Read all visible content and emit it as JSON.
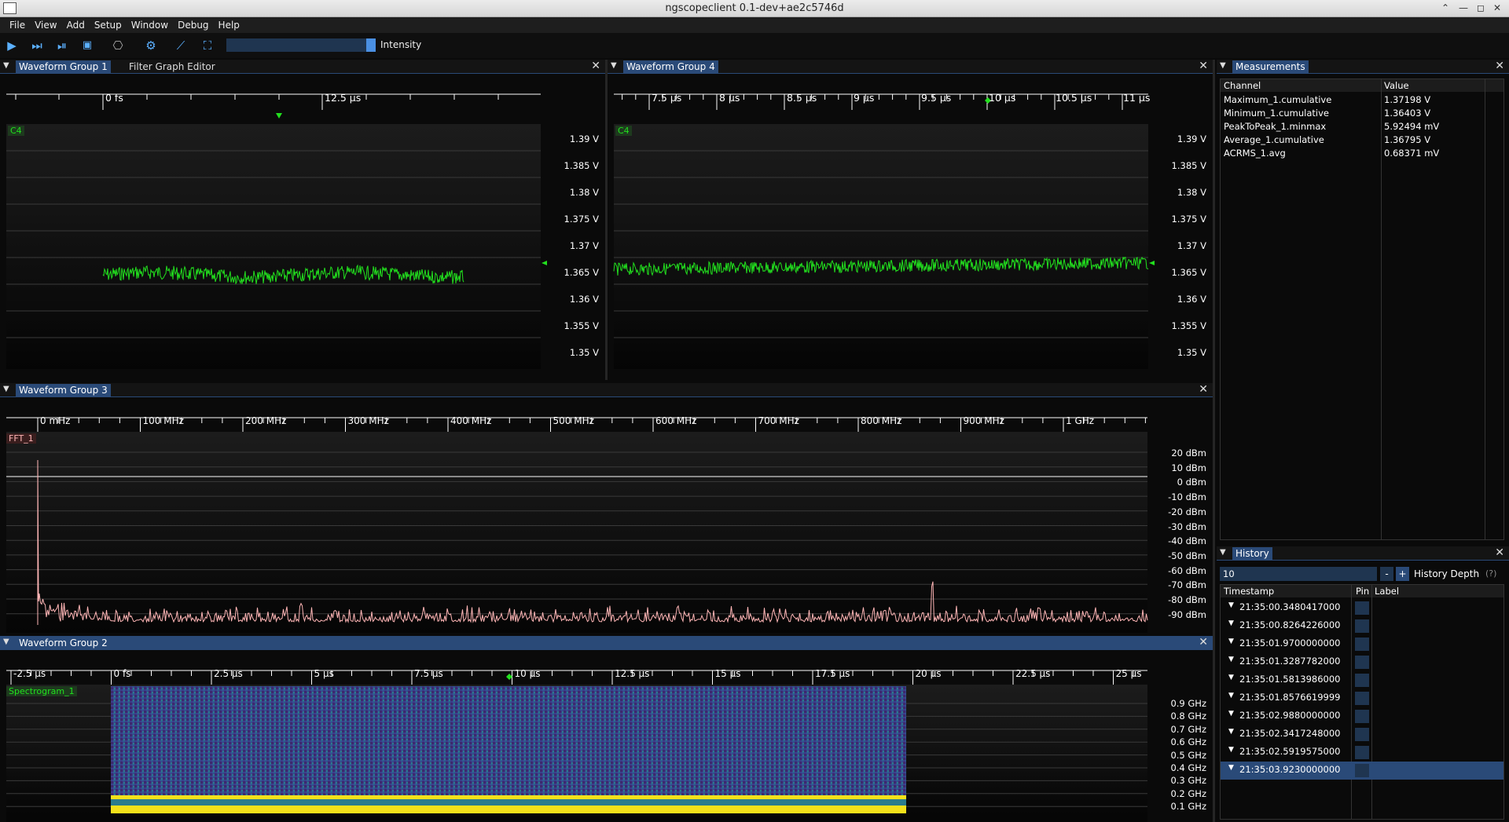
{
  "window": {
    "title": "ngscopeclient 0.1-dev+ae2c5746d"
  },
  "menu": [
    "File",
    "View",
    "Add",
    "Setup",
    "Window",
    "Debug",
    "Help"
  ],
  "toolbar": {
    "intensity_label": "Intensity",
    "icons": [
      "play-icon",
      "play-single-icon",
      "step-icon",
      "waveform-icon",
      "scope-icon",
      "settings-icon",
      "graph-icon",
      "fit-icon"
    ]
  },
  "wg1": {
    "tabs": [
      "Waveform Group 1",
      "Filter Graph Editor"
    ],
    "ticks": [
      "0 fs",
      "12.5 µs"
    ],
    "channel": "C4",
    "ylabels": [
      "1.39 V",
      "1.385 V",
      "1.38 V",
      "1.375 V",
      "1.37 V",
      "1.365 V",
      "1.36 V",
      "1.355 V",
      "1.35 V"
    ]
  },
  "wg4": {
    "tabs": [
      "Waveform Group 4"
    ],
    "ticks": [
      "7.5 µs",
      "8 µs",
      "8.5 µs",
      "9 µs",
      "9.5 µs",
      "10 µs",
      "10.5 µs",
      "11 µs"
    ],
    "channel": "C4",
    "ylabels": [
      "1.39 V",
      "1.385 V",
      "1.38 V",
      "1.375 V",
      "1.37 V",
      "1.365 V",
      "1.36 V",
      "1.355 V",
      "1.35 V"
    ]
  },
  "wg3": {
    "tabs": [
      "Waveform Group 3"
    ],
    "ticks": [
      "0 mHz",
      "100 MHz",
      "200 MHz",
      "300 MHz",
      "400 MHz",
      "500 MHz",
      "600 MHz",
      "700 MHz",
      "800 MHz",
      "900 MHz",
      "1 GHz"
    ],
    "channel": "FFT_1",
    "ylabels": [
      "20 dBm",
      "10 dBm",
      "0 dBm",
      "-10 dBm",
      "-20 dBm",
      "-30 dBm",
      "-40 dBm",
      "-50 dBm",
      "-60 dBm",
      "-70 dBm",
      "-80 dBm",
      "-90 dBm"
    ]
  },
  "wg2": {
    "tabs": [
      "Waveform Group 2"
    ],
    "ticks": [
      "-2.5 µs",
      "0 fs",
      "2.5 µs",
      "5 µs",
      "7.5 µs",
      "10 µs",
      "12.5 µs",
      "15 µs",
      "17.5 µs",
      "20 µs",
      "22.5 µs",
      "25 µs"
    ],
    "channel": "Spectrogram_1",
    "ylabels": [
      "0.9 GHz",
      "0.8 GHz",
      "0.7 GHz",
      "0.6 GHz",
      "0.5 GHz",
      "0.4 GHz",
      "0.3 GHz",
      "0.2 GHz",
      "0.1 GHz"
    ]
  },
  "measurements": {
    "title": "Measurements",
    "col_channel": "Channel",
    "col_value": "Value",
    "rows": [
      [
        "Maximum_1.cumulative",
        "1.37198 V"
      ],
      [
        "Minimum_1.cumulative",
        "1.36403 V"
      ],
      [
        "PeakToPeak_1.minmax",
        "5.92494 mV"
      ],
      [
        "Average_1.cumulative",
        "1.36795 V"
      ],
      [
        "ACRMS_1.avg",
        "0.68371 mV"
      ]
    ]
  },
  "history": {
    "title": "History",
    "depth_value": "10",
    "minus": "-",
    "plus": "+",
    "depth_label": "History Depth",
    "help": "(?)",
    "col_timestamp": "Timestamp",
    "col_pin": "Pin",
    "col_label": "Label",
    "rows": [
      "21:35:00.3480417000",
      "21:35:00.8264226000",
      "21:35:01.9700000000",
      "21:35:01.3287782000",
      "21:35:01.5813986000",
      "21:35:01.8576619999",
      "21:35:02.9880000000",
      "21:35:02.3417248000",
      "21:35:02.5919575000",
      "21:35:03.9230000000"
    ],
    "selected_index": 9
  },
  "colors": {
    "trace_green": "#22e01e",
    "fft_pink": "#ffb6b6",
    "accent": "#2a4a78"
  }
}
